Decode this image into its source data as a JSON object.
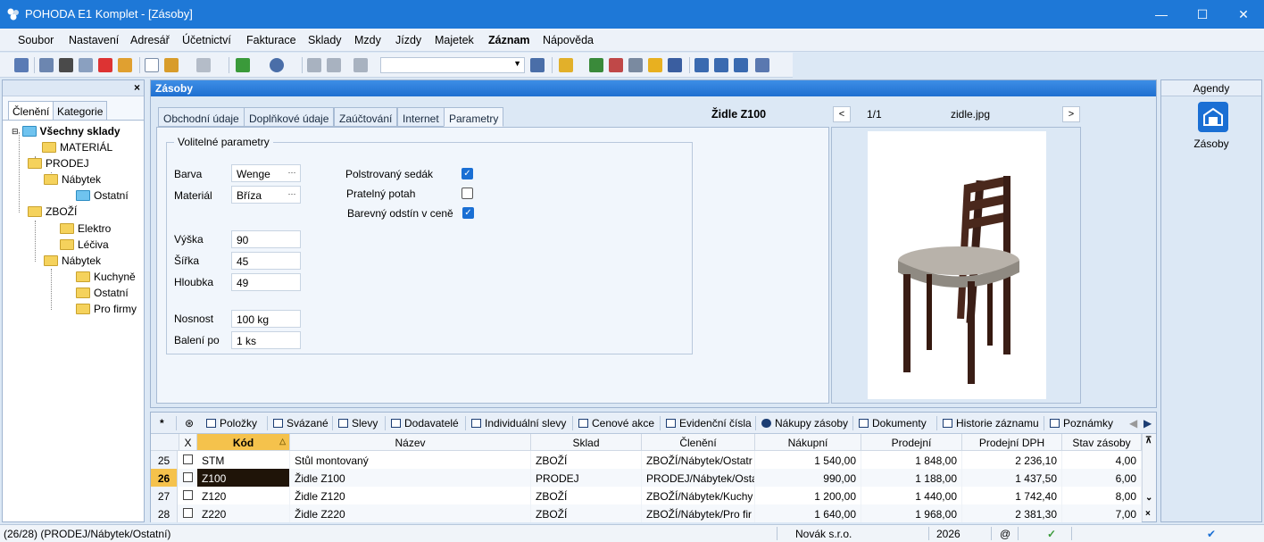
{
  "window": {
    "title": "POHODA E1 Komplet - [Zásoby]"
  },
  "menu": [
    "Soubor",
    "Nastavení",
    "Adresář",
    "Účetnictví",
    "Fakturace",
    "Sklady",
    "Mzdy",
    "Jízdy",
    "Majetek",
    "Záznam",
    "Nápověda"
  ],
  "left": {
    "tabs": [
      "Členění",
      "Kategorie"
    ],
    "close": "×",
    "tree": {
      "root": "Všechny sklady",
      "material": "MATERIÁL",
      "prodej": "PRODEJ",
      "prodej_nabytek": "Nábytek",
      "prodej_ostatni": "Ostatní",
      "zbozi": "ZBOŽÍ",
      "elektro": "Elektro",
      "leciva": "Léčiva",
      "zbozi_nabytek": "Nábytek",
      "kuchyne": "Kuchyně",
      "zbozi_ostatni": "Ostatní",
      "profirmy": "Pro firmy"
    }
  },
  "main": {
    "title": "Zásoby",
    "tabs": [
      "Obchodní údaje",
      "Doplňkové údaje",
      "Zaúčtování",
      "Internet",
      "Parametry"
    ],
    "record_name": "Židle Z100",
    "fieldset_title": "Volitelné parametry",
    "fields": {
      "barva_label": "Barva",
      "barva": "Wenge",
      "material_label": "Materiál",
      "material": "Bříza",
      "vyska_label": "Výška",
      "vyska": "90",
      "sirka_label": "Šířka",
      "sirka": "45",
      "hloubka_label": "Hloubka",
      "hloubka": "49",
      "nosnost_label": "Nosnost",
      "nosnost": "100 kg",
      "baleni_label": "Balení po",
      "baleni": "1 ks"
    },
    "checks": [
      {
        "label": "Polstrovaný sedák",
        "checked": true
      },
      {
        "label": "Pratelný potah",
        "checked": false
      },
      {
        "label": "Barevný odstín v ceně",
        "checked": true
      }
    ],
    "image": {
      "counter": "1/1",
      "filename": "zidle.jpg",
      "prev": "<",
      "next": ">"
    }
  },
  "agendy": {
    "header": "Agendy",
    "item": "Zásoby"
  },
  "bottom": {
    "tabs": [
      "Položky",
      "Svázané",
      "Slevy",
      "Dodavatelé",
      "Individuální slevy",
      "Cenové akce",
      "Evidenční čísla",
      "Nákupy zásoby",
      "Dokumenty",
      "Historie záznamu",
      "Poznámky"
    ],
    "columns": [
      "X",
      "Kód",
      "Název",
      "Sklad",
      "Členění",
      "Nákupní",
      "Prodejní",
      "Prodejní DPH",
      "Stav zásoby"
    ],
    "rows": [
      {
        "n": "25",
        "kod": "STM",
        "nazev": "Stůl montovaný",
        "sklad": "ZBOŽÍ",
        "cleneni": "ZBOŽÍ/Nábytek/Ostatr",
        "nakupni": "1 540,00",
        "prodejni": "1 848,00",
        "dph": "2 236,10",
        "stav": "4,00"
      },
      {
        "n": "26",
        "kod": "Z100",
        "nazev": "Židle Z100",
        "sklad": "PRODEJ",
        "cleneni": "PRODEJ/Nábytek/Osta",
        "nakupni": "990,00",
        "prodejni": "1 188,00",
        "dph": "1 437,50",
        "stav": "6,00"
      },
      {
        "n": "27",
        "kod": "Z120",
        "nazev": "Židle Z120",
        "sklad": "ZBOŽÍ",
        "cleneni": "ZBOŽÍ/Nábytek/Kuchy",
        "nakupni": "1 200,00",
        "prodejni": "1 440,00",
        "dph": "1 742,40",
        "stav": "8,00"
      },
      {
        "n": "28",
        "kod": "Z220",
        "nazev": "Židle Z220",
        "sklad": "ZBOŽÍ",
        "cleneni": "ZBOŽÍ/Nábytek/Pro fir",
        "nakupni": "1 640,00",
        "prodejni": "1 968,00",
        "dph": "2 381,30",
        "stav": "7,00"
      }
    ]
  },
  "status": {
    "path": "(26/28) (PRODEJ/Nábytek/Ostatní)",
    "company": "Novák s.r.o.",
    "year": "2026",
    "at": "@"
  },
  "colors": {
    "title_bar": "#1e78d7",
    "selected_row": "#f5c24c",
    "accent": "#1a6fd4"
  }
}
